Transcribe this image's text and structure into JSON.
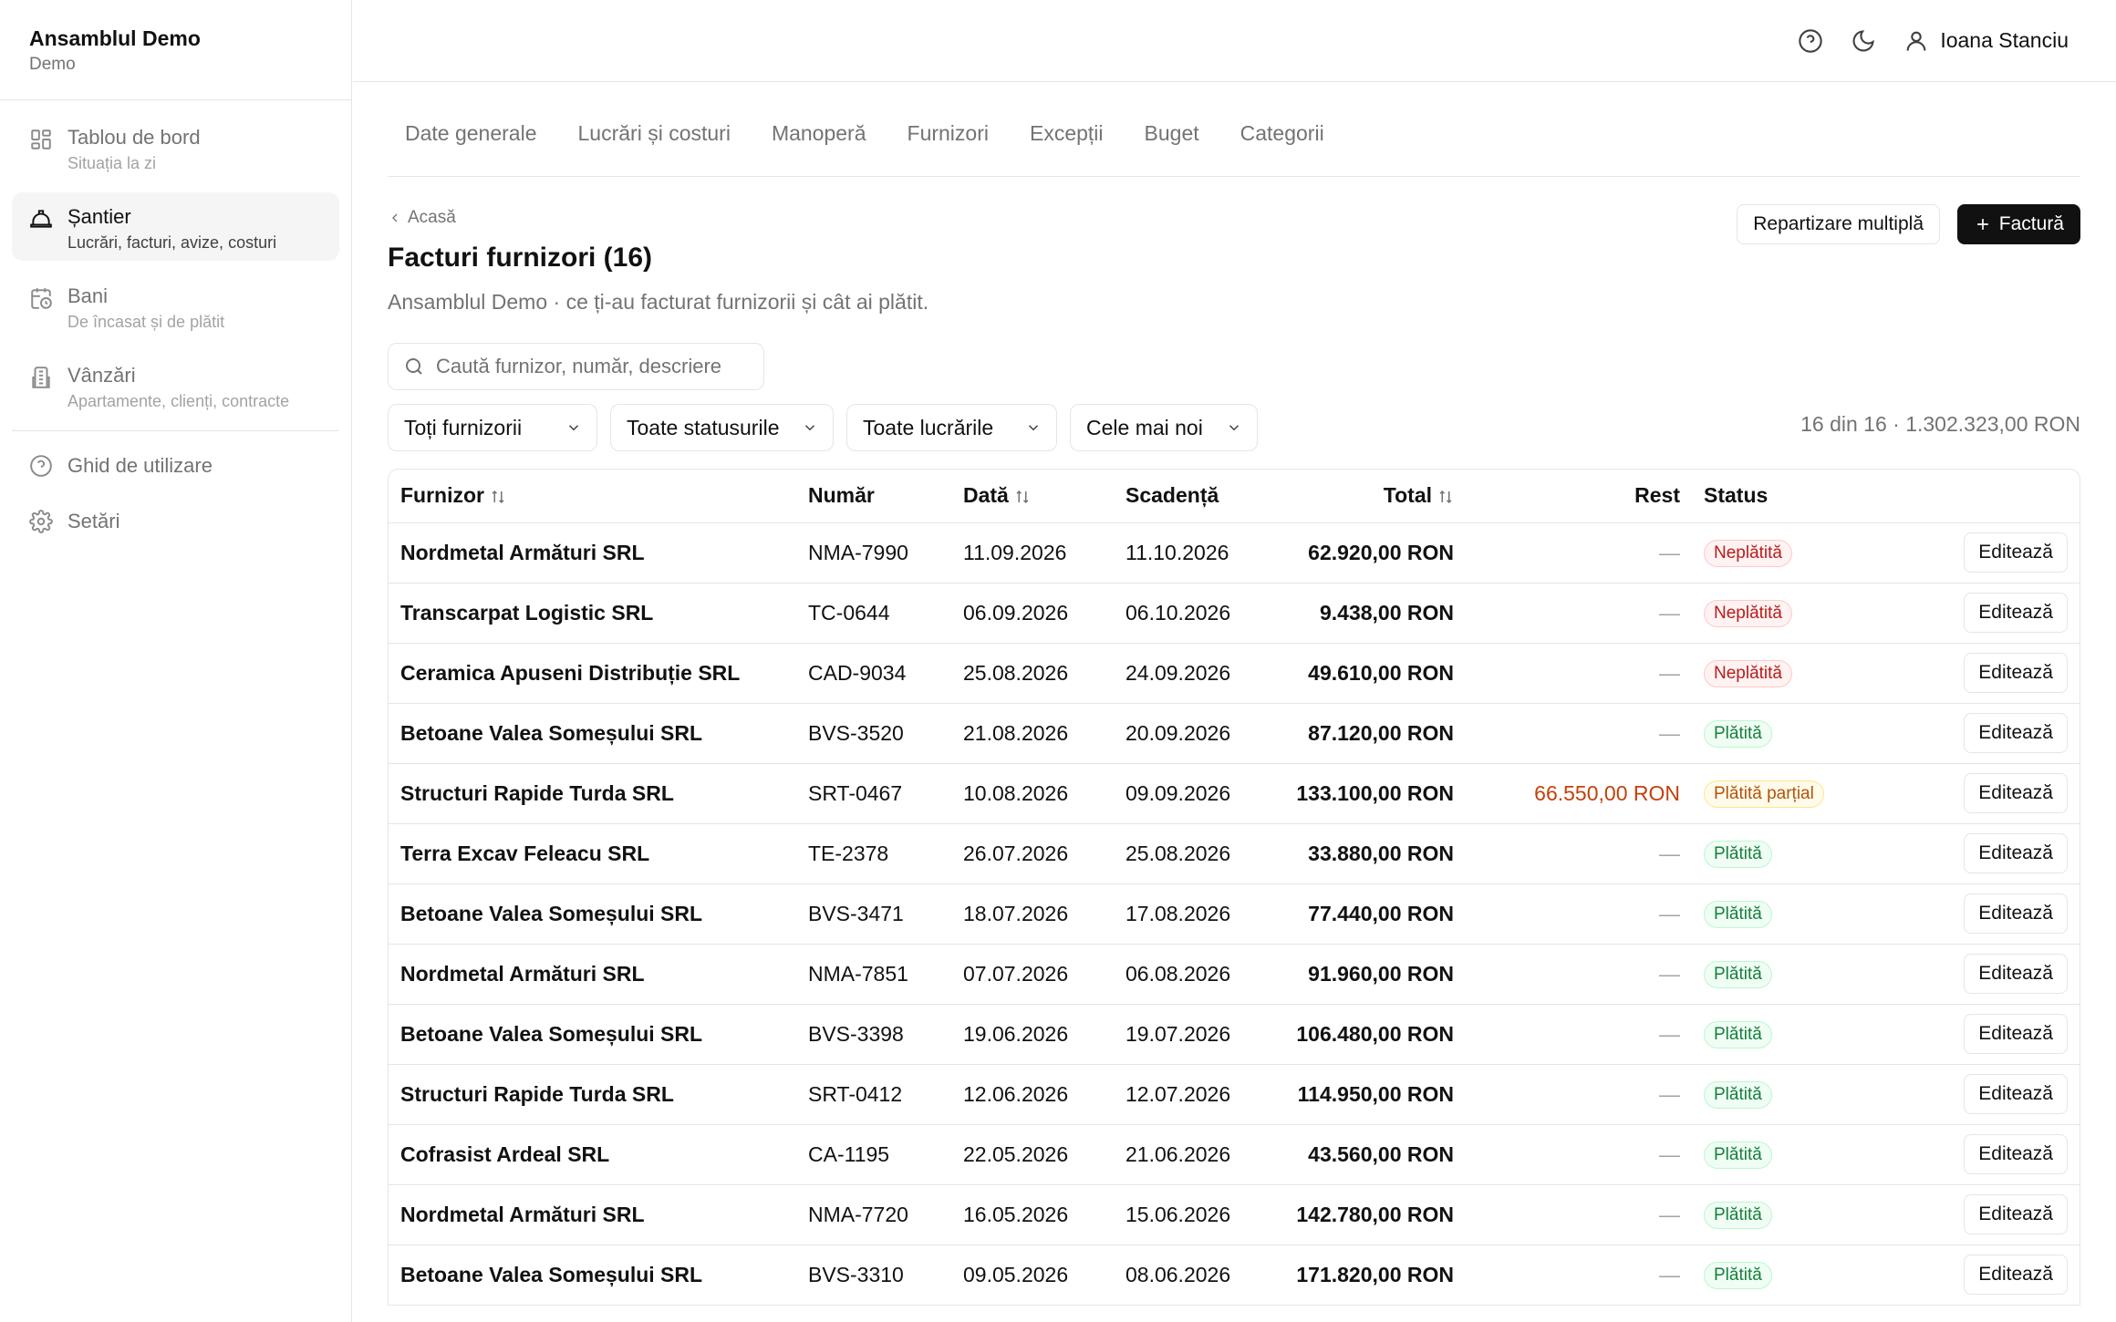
{
  "sidebar": {
    "brand_title": "Ansamblul Demo",
    "brand_sub": "Demo",
    "items": [
      {
        "label": "Tablou de bord",
        "sub": "Situația la zi",
        "icon": "dashboard-grid-icon"
      },
      {
        "label": "Șantier",
        "sub": "Lucrări, facturi, avize, costuri",
        "icon": "hard-hat-icon"
      },
      {
        "label": "Bani",
        "sub": "De încasat și de plătit",
        "icon": "calendar-clock-icon"
      },
      {
        "label": "Vânzări",
        "sub": "Apartamente, clienți, contracte",
        "icon": "building-icon"
      }
    ],
    "links": [
      {
        "label": "Ghid de utilizare",
        "icon": "help-circle-icon"
      },
      {
        "label": "Setări",
        "icon": "gear-icon"
      }
    ]
  },
  "topbar": {
    "user_name": "Ioana Stanciu"
  },
  "tabs": [
    "Date generale",
    "Lucrări și costuri",
    "Manoperă",
    "Furnizori",
    "Excepții",
    "Buget",
    "Categorii"
  ],
  "header": {
    "breadcrumb": "Acasă",
    "title": "Facturi furnizori (16)",
    "subtitle": "Ansamblul Demo · ce ți-au facturat furnizorii și cât ai plătit.",
    "btn_split": "Repartizare multiplă",
    "btn_invoice": "Factură",
    "search_placeholder": "Caută furnizor, număr, descriere"
  },
  "filters": {
    "supplier": "Toți furnizorii",
    "status": "Toate statusurile",
    "works": "Toate lucrările",
    "sort": "Cele mai noi",
    "summary": "16 din 16 · 1.302.323,00 RON"
  },
  "table": {
    "columns": {
      "supplier": "Furnizor",
      "number": "Număr",
      "date": "Dată",
      "due": "Scadență",
      "total": "Total",
      "rest": "Rest",
      "status": "Status"
    },
    "edit_label": "Editează",
    "rows": [
      {
        "supplier": "Nordmetal Armături SRL",
        "number": "NMA-7990",
        "date": "11.09.2026",
        "due": "11.10.2026",
        "total": "62.920,00 RON",
        "rest": "—",
        "status": "Neplătită",
        "kind": "unpaid"
      },
      {
        "supplier": "Transcarpat Logistic SRL",
        "number": "TC-0644",
        "date": "06.09.2026",
        "due": "06.10.2026",
        "total": "9.438,00 RON",
        "rest": "—",
        "status": "Neplătită",
        "kind": "unpaid"
      },
      {
        "supplier": "Ceramica Apuseni Distribuție SRL",
        "number": "CAD-9034",
        "date": "25.08.2026",
        "due": "24.09.2026",
        "total": "49.610,00 RON",
        "rest": "—",
        "status": "Neplătită",
        "kind": "unpaid"
      },
      {
        "supplier": "Betoane Valea Someșului SRL",
        "number": "BVS-3520",
        "date": "21.08.2026",
        "due": "20.09.2026",
        "total": "87.120,00 RON",
        "rest": "—",
        "status": "Plătită",
        "kind": "paid"
      },
      {
        "supplier": "Structuri Rapide Turda SRL",
        "number": "SRT-0467",
        "date": "10.08.2026",
        "due": "09.09.2026",
        "total": "133.100,00 RON",
        "rest": "66.550,00 RON",
        "status": "Plătită parțial",
        "kind": "partial"
      },
      {
        "supplier": "Terra Excav Feleacu SRL",
        "number": "TE-2378",
        "date": "26.07.2026",
        "due": "25.08.2026",
        "total": "33.880,00 RON",
        "rest": "—",
        "status": "Plătită",
        "kind": "paid"
      },
      {
        "supplier": "Betoane Valea Someșului SRL",
        "number": "BVS-3471",
        "date": "18.07.2026",
        "due": "17.08.2026",
        "total": "77.440,00 RON",
        "rest": "—",
        "status": "Plătită",
        "kind": "paid"
      },
      {
        "supplier": "Nordmetal Armături SRL",
        "number": "NMA-7851",
        "date": "07.07.2026",
        "due": "06.08.2026",
        "total": "91.960,00 RON",
        "rest": "—",
        "status": "Plătită",
        "kind": "paid"
      },
      {
        "supplier": "Betoane Valea Someșului SRL",
        "number": "BVS-3398",
        "date": "19.06.2026",
        "due": "19.07.2026",
        "total": "106.480,00 RON",
        "rest": "—",
        "status": "Plătită",
        "kind": "paid"
      },
      {
        "supplier": "Structuri Rapide Turda SRL",
        "number": "SRT-0412",
        "date": "12.06.2026",
        "due": "12.07.2026",
        "total": "114.950,00 RON",
        "rest": "—",
        "status": "Plătită",
        "kind": "paid"
      },
      {
        "supplier": "Cofrasist Ardeal SRL",
        "number": "CA-1195",
        "date": "22.05.2026",
        "due": "21.06.2026",
        "total": "43.560,00 RON",
        "rest": "—",
        "status": "Plătită",
        "kind": "paid"
      },
      {
        "supplier": "Nordmetal Armături SRL",
        "number": "NMA-7720",
        "date": "16.05.2026",
        "due": "15.06.2026",
        "total": "142.780,00 RON",
        "rest": "—",
        "status": "Plătită",
        "kind": "paid"
      },
      {
        "supplier": "Betoane Valea Someșului SRL",
        "number": "BVS-3310",
        "date": "09.05.2026",
        "due": "08.06.2026",
        "total": "171.820,00 RON",
        "rest": "—",
        "status": "Plătită",
        "kind": "paid"
      }
    ]
  },
  "colors": {
    "unpaid": "#b91c1c",
    "paid": "#15803d",
    "partial": "#b45309",
    "primary": "#111111"
  }
}
